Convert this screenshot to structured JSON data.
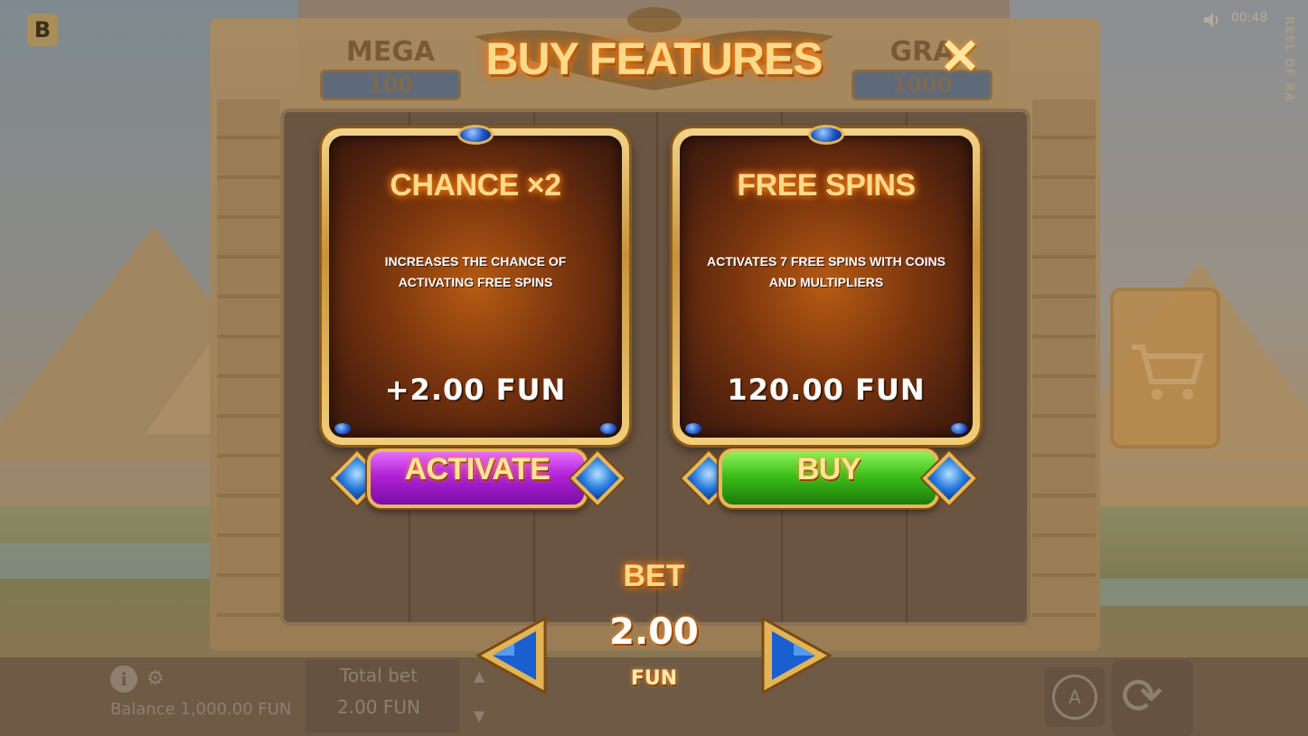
{
  "brand": {
    "logo_letter": "B",
    "game_name": "REEL OF RA"
  },
  "status": {
    "time": "00:48"
  },
  "jackpots": [
    {
      "name": "MEGA",
      "value": "100"
    },
    {
      "name": "GRA",
      "value": "1000"
    }
  ],
  "modal": {
    "title": "BUY FEATURES",
    "close_icon": "close-icon",
    "features": [
      {
        "title": "CHANCE ×2",
        "description": "INCREASES THE CHANCE OF ACTIVATING FREE SPINS",
        "price": "+2.00  FUN",
        "button_label": "ACTIVATE",
        "button_color": "#b021d6"
      },
      {
        "title": "FREE SPINS",
        "description": "ACTIVATES 7 FREE SPINS WITH COINS AND MULTIPLIERS",
        "price": "120.00  FUN",
        "button_label": "BUY",
        "button_color": "#3cbf1a"
      }
    ],
    "bet": {
      "label": "BET",
      "value": "2.00",
      "unit": "FUN"
    }
  },
  "bottom_bar": {
    "balance": "Balance 1,000.00 FUN",
    "total_bet_label": "Total bet",
    "total_bet_value": "2.00 FUN",
    "auto_label": "A"
  },
  "colors": {
    "title_glow": "#ff8a1a",
    "title_text": "#ffd98a",
    "gem_blue": "#1d54c8"
  }
}
